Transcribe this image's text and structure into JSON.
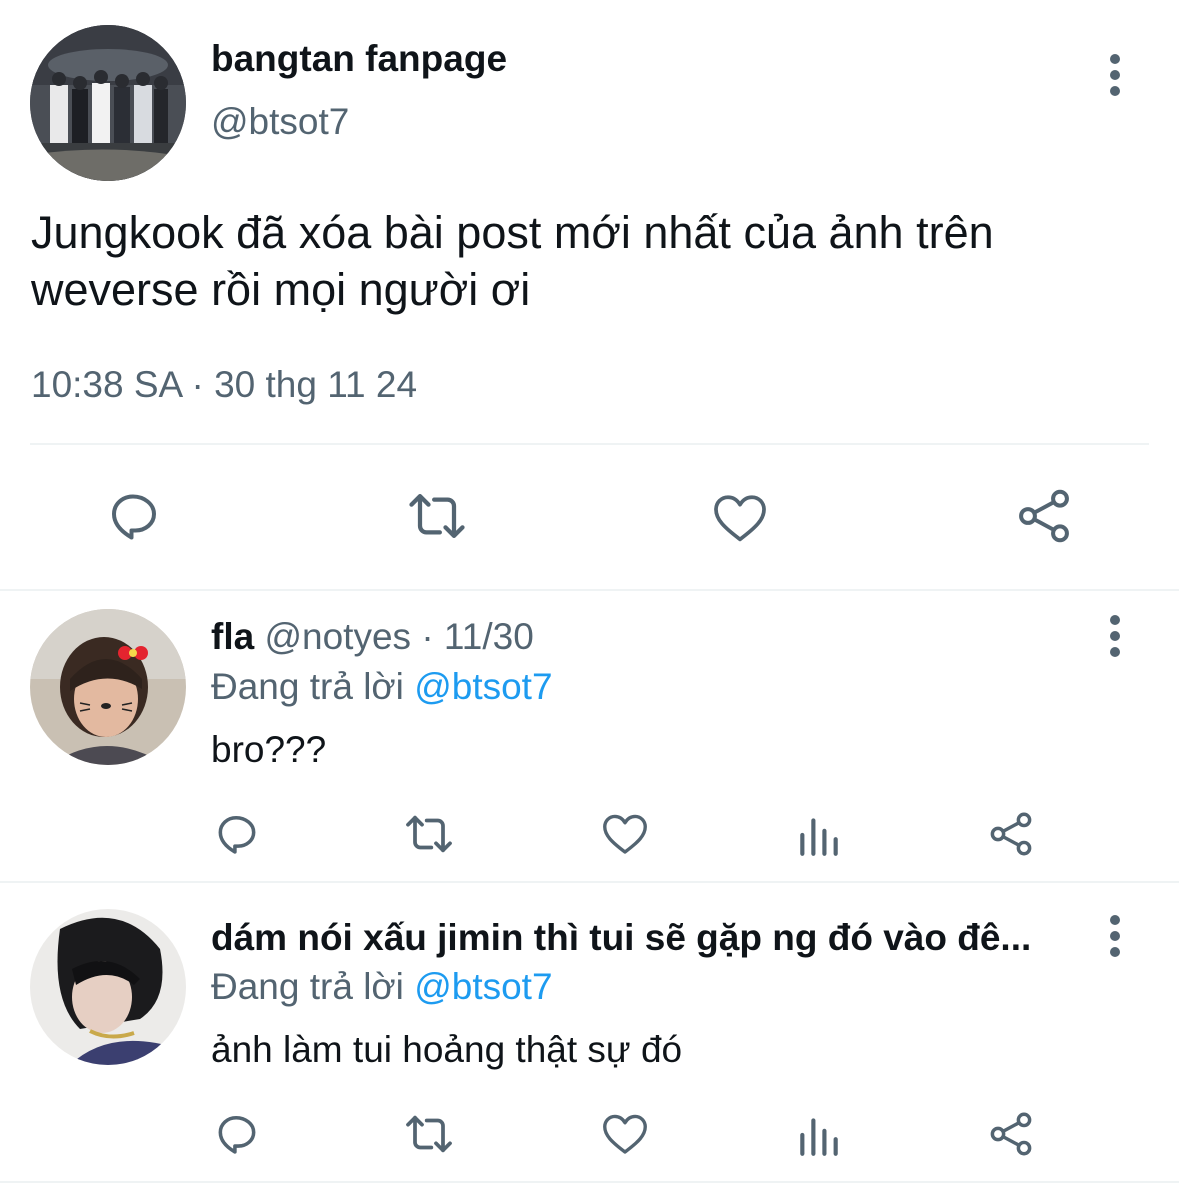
{
  "main_tweet": {
    "display_name": "bangtan fanpage",
    "handle": "@btsot7",
    "text_line1": "Jungkook đã xóa bài post mới nhất của ảnh trên",
    "text_line2": "weverse rồi mọi người ơi",
    "timestamp": "10:38 SA · 30 thg 11 24",
    "avatar": "group-photo-avatar"
  },
  "replies": [
    {
      "display_name": "fla",
      "handle": "@notyes",
      "date": "· 11/30",
      "replying_prefix": "Đang trả lời",
      "replying_to": "@btsot7",
      "text": "bro???",
      "avatar": "person-with-bow-avatar"
    },
    {
      "display_name": "dám nói xấu jimin thì tui sẽ gặp ng đó vào đê...",
      "replying_prefix": "Đang trả lời",
      "replying_to": "@btsot7",
      "text": "ảnh làm tui hoảng thật sự đó",
      "avatar": "dark-hair-person-avatar"
    }
  ],
  "colors": {
    "text": "#0f1419",
    "muted": "#536471",
    "link": "#1d9bf0",
    "icon": "#536471",
    "divider": "#eff3f4"
  }
}
